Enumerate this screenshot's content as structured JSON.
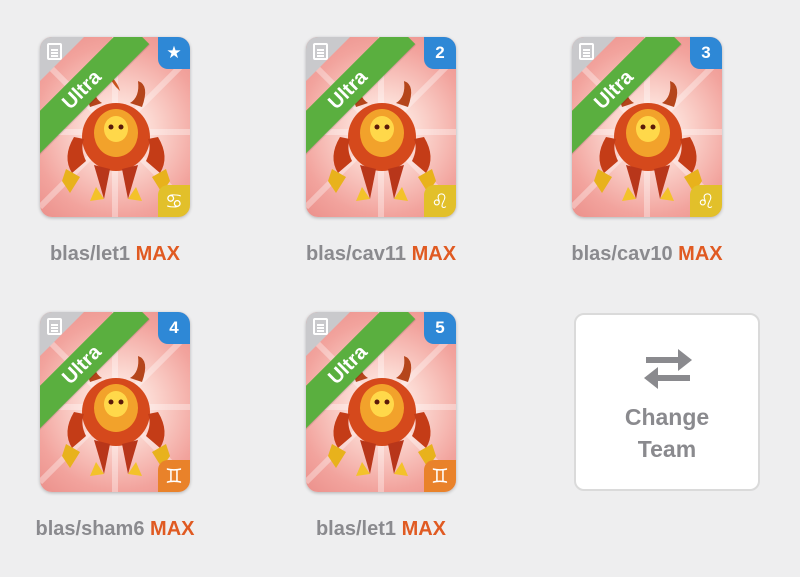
{
  "team": {
    "slots": [
      {
        "grade": "Ultra",
        "badge": "★",
        "badge_icon": "star-icon",
        "zodiac": "♋",
        "zodiac_icon": "cancer-icon",
        "zodiac_color": "#e2c02a",
        "name": "blas/let1",
        "level": "MAX"
      },
      {
        "grade": "Ultra",
        "badge": "2",
        "badge_icon": "",
        "zodiac": "♌",
        "zodiac_icon": "leo-icon",
        "zodiac_color": "#e2c02a",
        "name": "blas/cav11",
        "level": "MAX"
      },
      {
        "grade": "Ultra",
        "badge": "3",
        "badge_icon": "",
        "zodiac": "♌",
        "zodiac_icon": "leo-icon",
        "zodiac_color": "#e2c02a",
        "name": "blas/cav10",
        "level": "MAX"
      },
      {
        "grade": "Ultra",
        "badge": "4",
        "badge_icon": "",
        "zodiac": "♊",
        "zodiac_icon": "gemini-icon",
        "zodiac_color": "#e9822a",
        "name": "blas/sham6",
        "level": "MAX"
      },
      {
        "grade": "Ultra",
        "badge": "5",
        "badge_icon": "",
        "zodiac": "♊",
        "zodiac_icon": "gemini-icon",
        "zodiac_color": "#e9822a",
        "name": "blas/let1",
        "level": "MAX"
      }
    ]
  },
  "change_team": {
    "label_line1": "Change",
    "label_line2": "Team",
    "icon": "swap-arrows-icon"
  },
  "colors": {
    "ribbon": "#5aaf3f",
    "number_badge": "#2e88d6",
    "max_text": "#e05a22",
    "name_text": "#8a8a8e"
  }
}
